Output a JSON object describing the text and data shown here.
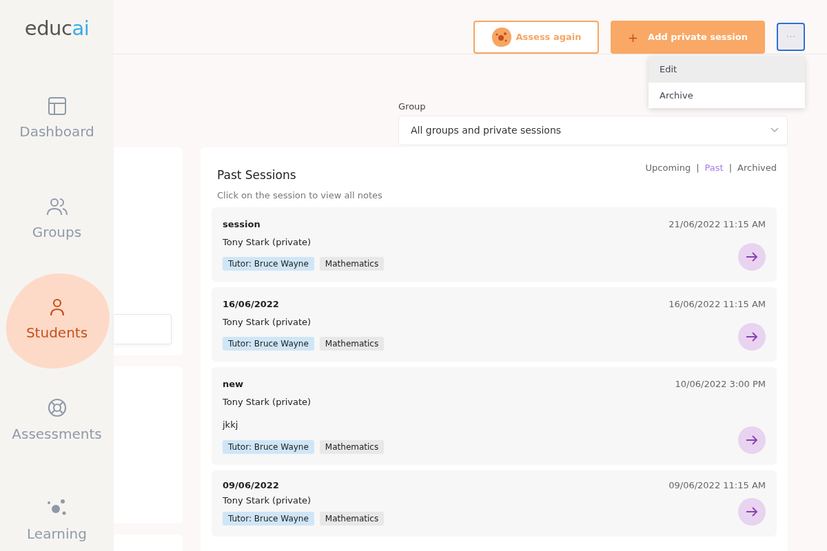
{
  "logo": {
    "main": "educ",
    "accent": "ai"
  },
  "sidebar": {
    "items": [
      {
        "kind": "dashboard",
        "label": "Dashboard",
        "selected": false
      },
      {
        "kind": "groups",
        "label": "Groups",
        "selected": false
      },
      {
        "kind": "students",
        "label": "Students",
        "selected": true
      },
      {
        "kind": "assessments",
        "label": "Assessments",
        "selected": false
      },
      {
        "kind": "learning",
        "label": "Learning",
        "selected": false
      }
    ]
  },
  "header": {
    "assess_button": "Assess again",
    "add_button": {
      "icon": "+",
      "label": "Add private session"
    },
    "more_button": "···",
    "menu": [
      {
        "label": "Edit",
        "selected": true
      },
      {
        "label": "Archive",
        "selected": false
      }
    ]
  },
  "filter": {
    "label": "Group",
    "value": "All groups and private sessions"
  },
  "sessions_panel": {
    "title": "Past Sessions",
    "subtitle": "Click on the session to view all notes",
    "tabs": [
      {
        "label": "Upcoming",
        "selected": false
      },
      {
        "label": "Past",
        "selected": true
      },
      {
        "label": "Archived",
        "selected": false
      }
    ],
    "tab_separator": "|",
    "sessions": [
      {
        "title": "session",
        "student": "Tony Stark (private)",
        "date": "21/06/2022 11:15 AM",
        "tags": [
          "Tutor: Bruce Wayne",
          "Mathematics"
        ]
      },
      {
        "title": "16/06/2022",
        "student": "Tony Stark (private)",
        "date": "16/06/2022 11:15 AM",
        "tags": [
          "Tutor: Bruce Wayne",
          "Mathematics"
        ]
      },
      {
        "title": "new",
        "student": "Tony Stark (private)",
        "date": "10/06/2022 3:00 PM",
        "note": "jkkj",
        "tags": [
          "Tutor: Bruce Wayne",
          "Mathematics"
        ]
      },
      {
        "title": "09/06/2022",
        "student": "Tony Stark (private)",
        "date": "09/06/2022 11:15 AM",
        "tags": [
          "Tutor: Bruce Wayne",
          "Mathematics"
        ]
      }
    ]
  }
}
